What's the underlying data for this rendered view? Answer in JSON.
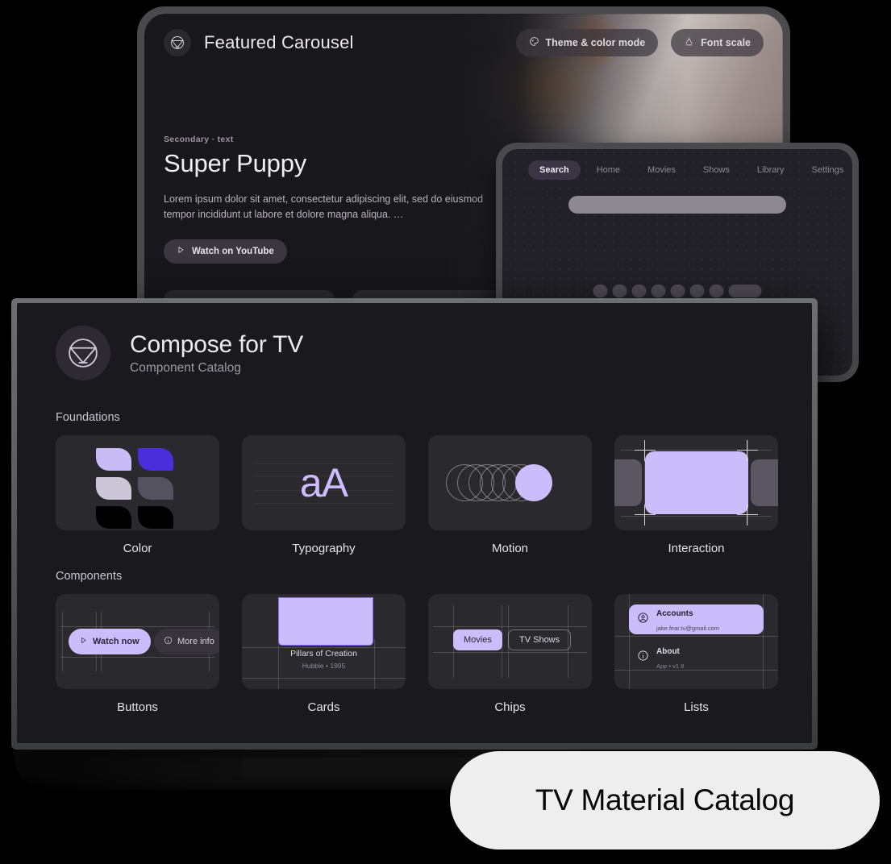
{
  "caption": {
    "text": "TV Material Catalog"
  },
  "tablet": {
    "topbar": {
      "title": "Featured Carousel",
      "logo_icon": "compose-tv-logo-icon",
      "buttons": [
        {
          "label": "Theme & color mode",
          "icon": "palette-icon"
        },
        {
          "label": "Font scale",
          "icon": "font-size-icon"
        }
      ]
    },
    "hero": {
      "eyebrow": "Secondary · text",
      "title": "Super Puppy",
      "description": "Lorem ipsum dolor sit amet, consectetur adipiscing elit, sed do eiusmod tempor incididunt ut labore et dolore magna aliqua. …",
      "cta": {
        "label": "Watch on YouTube",
        "icon": "play-icon"
      }
    }
  },
  "overlay": {
    "tabs": [
      {
        "label": "Search",
        "selected": true
      },
      {
        "label": "Home",
        "selected": false
      },
      {
        "label": "Movies",
        "selected": false
      },
      {
        "label": "Shows",
        "selected": false
      },
      {
        "label": "Library",
        "selected": false
      },
      {
        "label": "Settings",
        "selected": false
      }
    ],
    "search_field": {
      "value": "",
      "placeholder": ""
    },
    "keyboard": {
      "rows": [
        8,
        8,
        8,
        8
      ],
      "space_keys": 3
    }
  },
  "tv": {
    "header": {
      "logo_icon": "compose-tv-logo-icon",
      "title": "Compose for TV",
      "subtitle": "Component Catalog"
    },
    "sections": [
      {
        "label": "Foundations",
        "items": [
          {
            "label": "Color",
            "preview": "color-swatches",
            "swatches": [
              "#c8bcf7",
              "#4a2ddb",
              "#cbc7d6",
              "#55525f",
              "#000000",
              "#000000"
            ]
          },
          {
            "label": "Typography",
            "preview": "type-sample",
            "sample": "aA",
            "sample_color": "#ccbcfb"
          },
          {
            "label": "Motion",
            "preview": "motion-trail",
            "accent": "#cbbcfb"
          },
          {
            "label": "Interaction",
            "preview": "focus-state",
            "accent": "#cbbcfb"
          }
        ]
      },
      {
        "label": "Components",
        "items": [
          {
            "label": "Buttons",
            "preview": "buttons",
            "primary": {
              "label": "Watch now",
              "icon": "play-icon"
            },
            "secondary": {
              "label": "More info",
              "icon": "info-icon"
            }
          },
          {
            "label": "Cards",
            "preview": "card",
            "card_title": "Pillars of Creation",
            "card_subtitle": "Hubble • 1995"
          },
          {
            "label": "Chips",
            "preview": "chips",
            "chips": [
              {
                "label": "Movies",
                "selected": true
              },
              {
                "label": "TV Shows",
                "selected": false
              }
            ]
          },
          {
            "label": "Lists",
            "preview": "lists",
            "rows": [
              {
                "title": "Accounts",
                "subtitle": "jake.fear.tv@gmail.com",
                "icon": "account-icon",
                "selected": true
              },
              {
                "title": "About",
                "subtitle": "App • v1.8",
                "icon": "info-icon",
                "selected": false
              }
            ]
          }
        ]
      }
    ]
  },
  "colors": {
    "accent": "#cbbcfb",
    "accent_deep": "#4a2ddb",
    "surface": "#2a2a2e",
    "background": "#1a1a1e",
    "caption_bg": "#eeeeee"
  }
}
